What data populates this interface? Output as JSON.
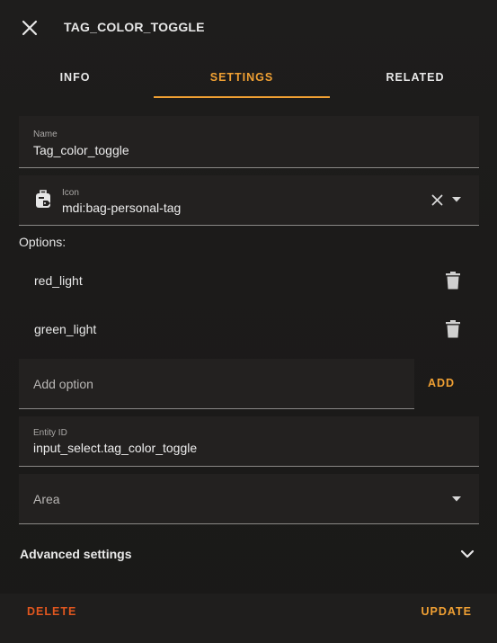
{
  "header": {
    "title": "TAG_COLOR_TOGGLE"
  },
  "tabs": [
    {
      "label": "INFO"
    },
    {
      "label": "SETTINGS",
      "active": true
    },
    {
      "label": "RELATED"
    }
  ],
  "form": {
    "name": {
      "label": "Name",
      "value": "Tag_color_toggle"
    },
    "icon": {
      "label": "Icon",
      "value": "mdi:bag-personal-tag",
      "icon_name": "bag-personal-tag-icon"
    },
    "options_label": "Options:",
    "options": [
      {
        "label": "red_light"
      },
      {
        "label": "green_light"
      }
    ],
    "add_option": {
      "placeholder": "Add option",
      "button": "ADD"
    },
    "entity_id": {
      "label": "Entity ID",
      "value": "input_select.tag_color_toggle"
    },
    "area": {
      "placeholder": "Area"
    },
    "advanced": {
      "label": "Advanced settings"
    }
  },
  "footer": {
    "delete": "DELETE",
    "update": "UPDATE"
  },
  "colors": {
    "accent": "#f0a033",
    "danger": "#e0561e",
    "background": "#1c1b1a",
    "field": "#232120"
  }
}
